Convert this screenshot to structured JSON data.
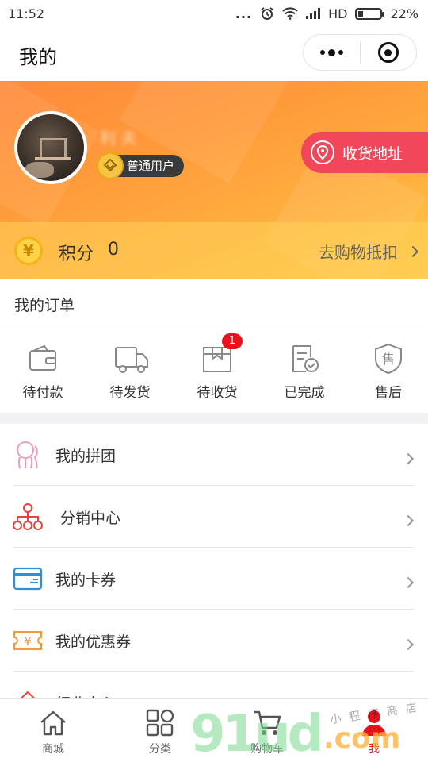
{
  "status_bar": {
    "time": "11:52",
    "dots": "...",
    "network": "HD",
    "battery": "22%",
    "battery_level": 0.22
  },
  "nav": {
    "title": "我的"
  },
  "profile": {
    "username": "利 夫",
    "user_level": "普通用户",
    "address_button": "收货地址"
  },
  "points": {
    "label": "积分",
    "value": "0",
    "redeem_link": "去购物抵扣"
  },
  "orders": {
    "title": "我的订单",
    "items": [
      {
        "label": "待付款",
        "icon": "wallet-icon"
      },
      {
        "label": "待发货",
        "icon": "truck-icon"
      },
      {
        "label": "待收货",
        "icon": "package-icon",
        "badge": "1"
      },
      {
        "label": "已完成",
        "icon": "order-complete-icon"
      },
      {
        "label": "售后",
        "icon": "after-sale-icon"
      }
    ]
  },
  "menu": [
    {
      "label": "我的拼团",
      "icon": "group-buy-icon"
    },
    {
      "label": "分销中心",
      "icon": "distribution-icon"
    },
    {
      "label": "我的卡券",
      "icon": "card-icon"
    },
    {
      "label": "我的优惠券",
      "icon": "coupon-icon"
    },
    {
      "label": "行业中心",
      "icon": "house-icon"
    }
  ],
  "tabs": [
    {
      "label": "商城",
      "icon": "home-icon"
    },
    {
      "label": "分类",
      "icon": "category-icon"
    },
    {
      "label": "购物车",
      "icon": "cart-icon"
    },
    {
      "label": "我",
      "icon": "user-icon",
      "active": true
    }
  ],
  "watermark": {
    "text": "91ud",
    "domain": ".com",
    "tagline": "小程序商店"
  },
  "colors": {
    "accent_red": "#e8121c",
    "header_orange": "#ff8a3c",
    "address_btn": "#f2475a",
    "coin_gold": "#ffd24a"
  }
}
